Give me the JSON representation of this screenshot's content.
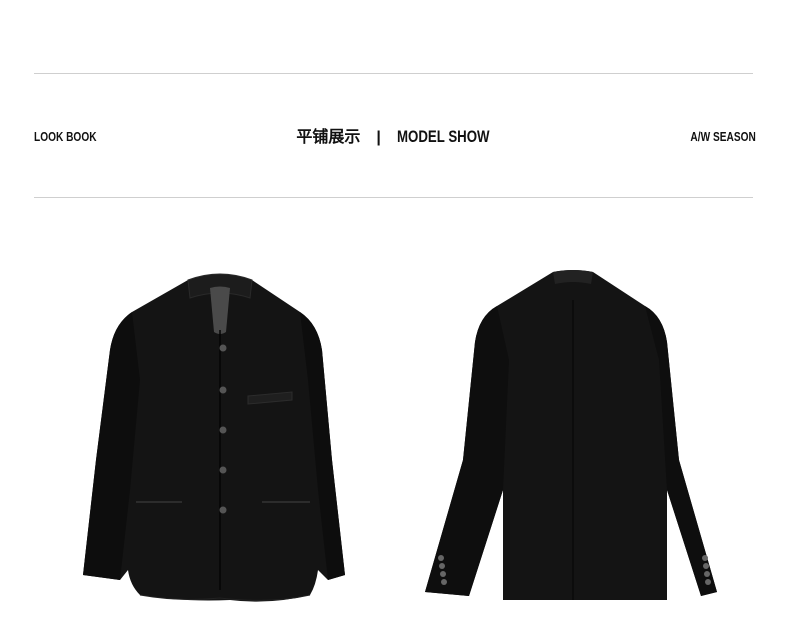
{
  "header": {
    "left_label": "LOOK BOOK",
    "center_zh": "平铺展示",
    "separator": "|",
    "center_en": "MODEL SHOW",
    "right_label": "A/W SEASON"
  },
  "colors": {
    "garment": "#141414",
    "rule": "#cfcfcf"
  },
  "images": [
    {
      "name": "jacket-front-photo",
      "view": "front"
    },
    {
      "name": "jacket-back-photo",
      "view": "back"
    }
  ]
}
